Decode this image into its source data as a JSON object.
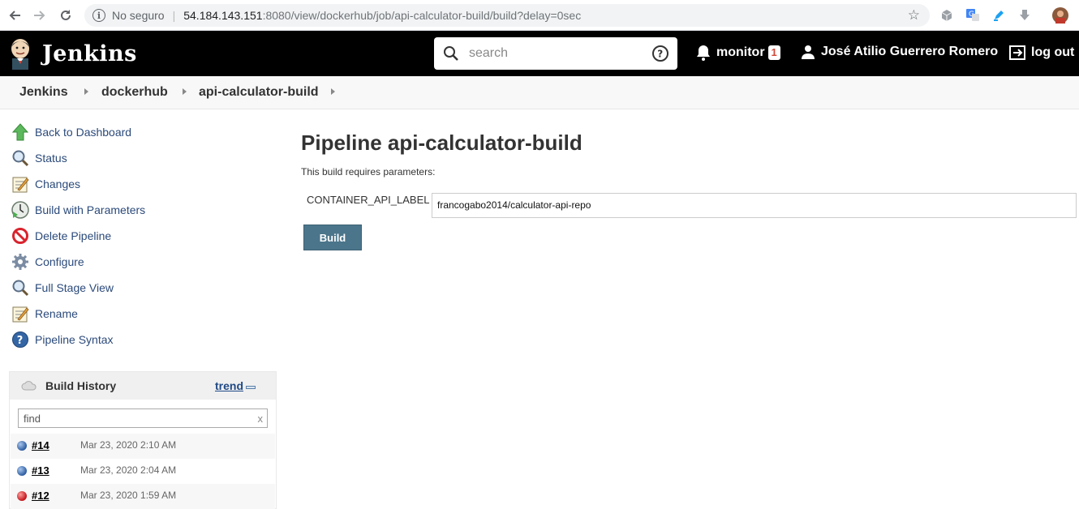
{
  "browser": {
    "security_label": "No seguro",
    "url_host": "54.184.143.151",
    "url_path": ":8080/view/dockerhub/job/api-calculator-build/build?delay=0sec"
  },
  "header": {
    "app_title": "Jenkins",
    "search_placeholder": "search",
    "monitor_label": "monitor",
    "monitor_count": "1",
    "user_name": "José Atilio Guerrero Romero",
    "logout_label": "log out"
  },
  "breadcrumb": [
    "Jenkins",
    "dockerhub",
    "api-calculator-build"
  ],
  "sidebar": {
    "items": [
      {
        "label": "Back to Dashboard",
        "icon": "up-arrow-icon"
      },
      {
        "label": "Status",
        "icon": "magnifier-icon"
      },
      {
        "label": "Changes",
        "icon": "notepad-icon"
      },
      {
        "label": "Build with Parameters",
        "icon": "clock-play-icon"
      },
      {
        "label": "Delete Pipeline",
        "icon": "no-entry-icon"
      },
      {
        "label": "Configure",
        "icon": "gear-icon"
      },
      {
        "label": "Full Stage View",
        "icon": "magnifier-icon"
      },
      {
        "label": "Rename",
        "icon": "notepad-icon"
      },
      {
        "label": "Pipeline Syntax",
        "icon": "help-icon"
      }
    ]
  },
  "build_history": {
    "title": "Build History",
    "trend_label": "trend",
    "find_placeholder": "find",
    "clear_label": "x",
    "builds": [
      {
        "number": "#14",
        "date": "Mar 23, 2020 2:10 AM",
        "status": "blue"
      },
      {
        "number": "#13",
        "date": "Mar 23, 2020 2:04 AM",
        "status": "blue"
      },
      {
        "number": "#12",
        "date": "Mar 23, 2020 1:59 AM",
        "status": "red"
      }
    ]
  },
  "main": {
    "title": "Pipeline api-calculator-build",
    "description": "This build requires parameters:",
    "param_name": "CONTAINER_API_LABEL",
    "param_value": "francogabo2014/calculator-api-repo",
    "build_button": "Build"
  },
  "colors": {
    "header_bg": "#000000",
    "build_button": "#4b758b",
    "badge_text": "#d24939"
  }
}
